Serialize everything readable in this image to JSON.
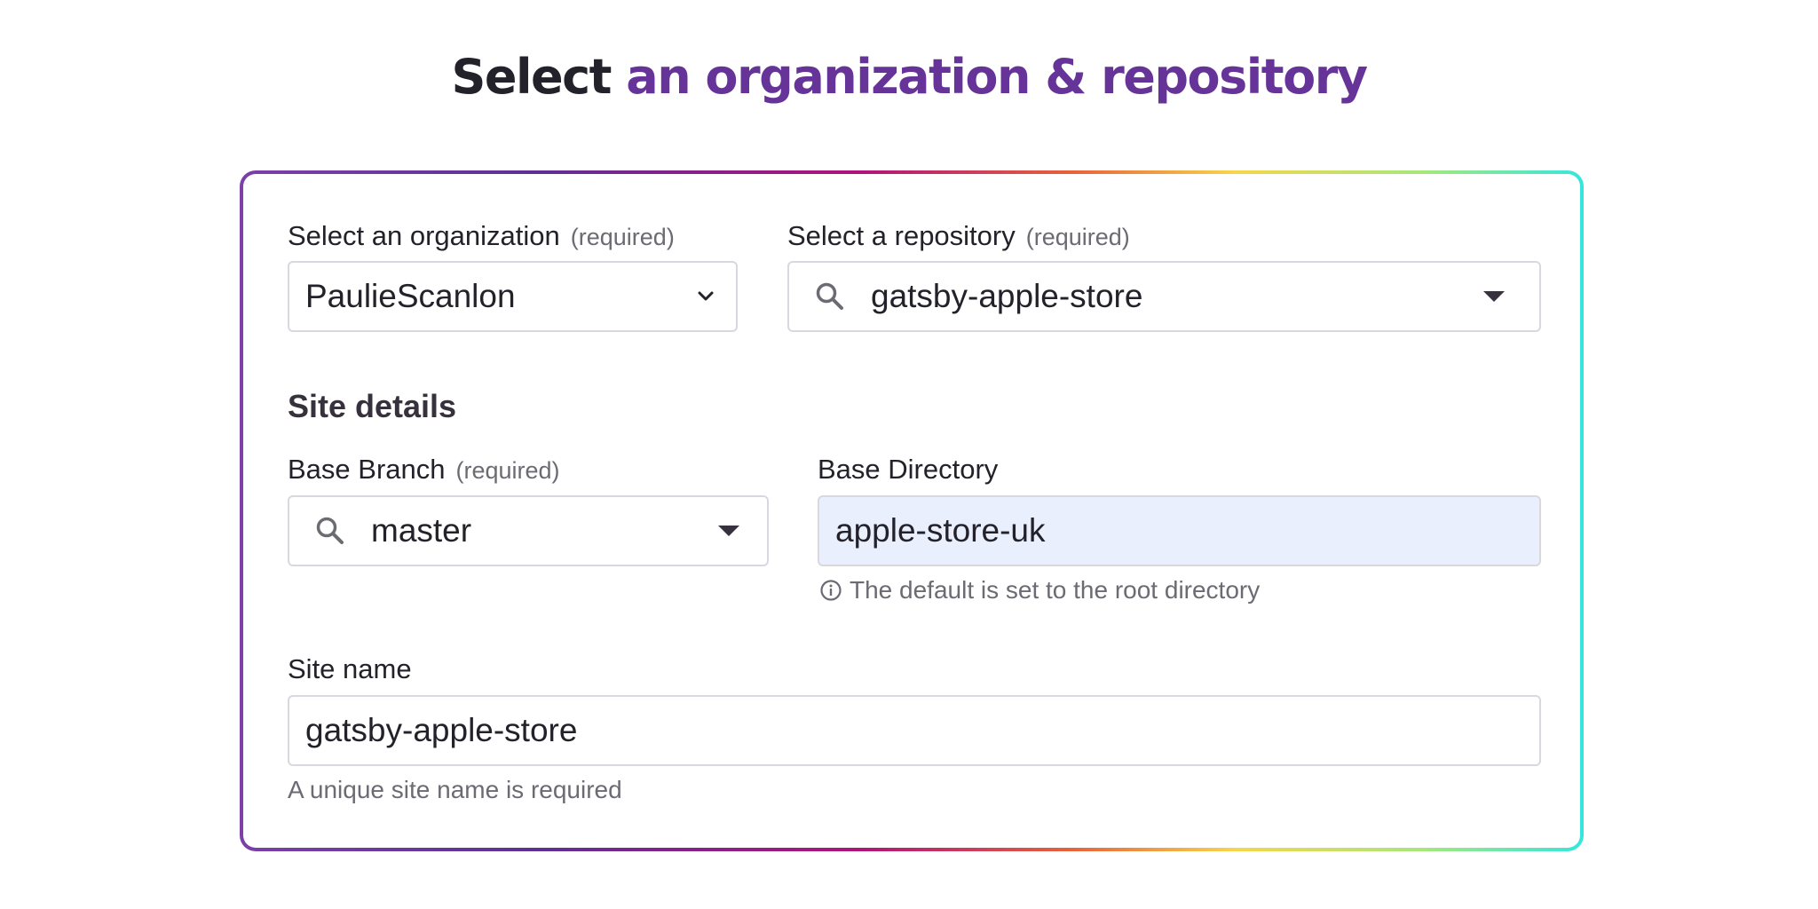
{
  "header": {
    "title_strong": "Select",
    "title_accent": "an organization & repository"
  },
  "colors": {
    "accent": "#663399",
    "text": "#232129",
    "muted": "#6b6b73",
    "field_border": "#d9d7e0",
    "filled_field_bg": "#eaeffd"
  },
  "organization": {
    "label": "Select an organization",
    "required_label": "(required)",
    "value": "PaulieScanlon",
    "icon": "chevron-down-icon"
  },
  "repository": {
    "label": "Select a repository",
    "required_label": "(required)",
    "value": "gatsby-apple-store",
    "icon": "search-icon",
    "caret_icon": "caret-down-icon"
  },
  "site_details": {
    "heading": "Site details"
  },
  "base_branch": {
    "label": "Base Branch",
    "required_label": "(required)",
    "value": "master",
    "icon": "search-icon",
    "caret_icon": "caret-down-icon"
  },
  "base_directory": {
    "label": "Base Directory",
    "value": "apple-store-uk",
    "hint": "The default is set to the root directory",
    "hint_icon": "info-icon"
  },
  "site_name": {
    "label": "Site name",
    "value": "gatsby-apple-store",
    "hint": "A unique site name is required"
  }
}
